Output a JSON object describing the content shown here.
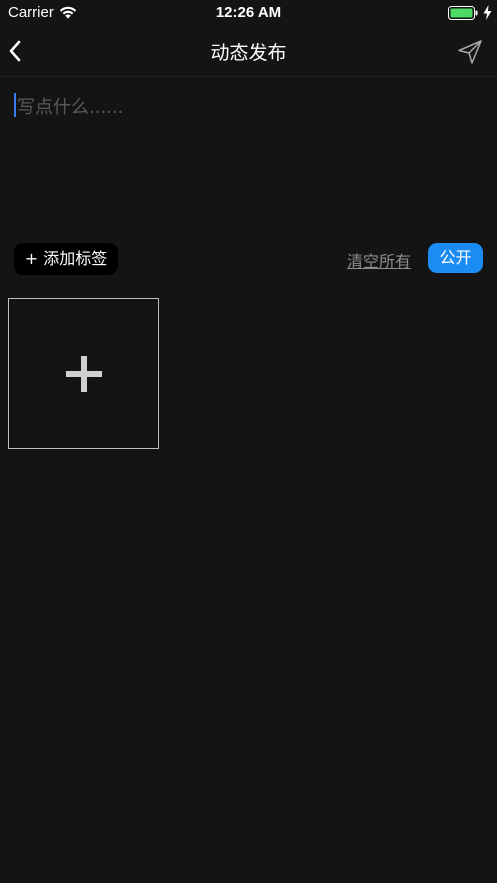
{
  "status_bar": {
    "carrier": "Carrier",
    "time": "12:26 AM",
    "wifi_icon": "wifi-icon",
    "battery_icon": "battery-full-icon",
    "charging_icon": "charging-bolt-icon",
    "battery_color": "#4cd964"
  },
  "nav": {
    "back_icon": "chevron-left-icon",
    "title": "动态发布",
    "send_icon": "paper-plane-icon"
  },
  "compose": {
    "placeholder": "写点什么......",
    "caret_color": "#3b7cf5"
  },
  "actions": {
    "add_tag_label": "+ 添加标签",
    "clear_all_label": "清空所有",
    "visibility_label": "公开",
    "visibility_color": "#1c8cf5"
  },
  "media": {
    "add_image_icon": "plus-icon"
  }
}
